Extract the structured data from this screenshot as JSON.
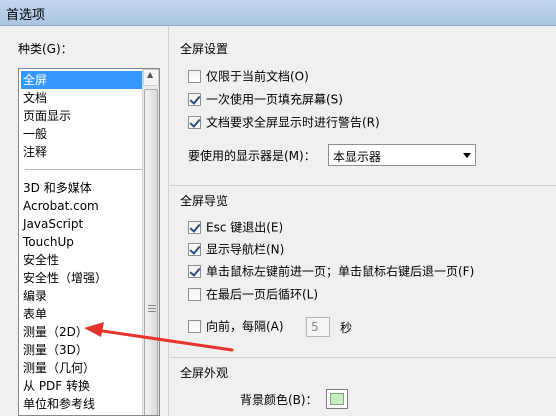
{
  "window": {
    "title": "首选项"
  },
  "categories": {
    "label": "种类(G)：",
    "group1": [
      "全屏",
      "文档",
      "页面显示",
      "一般",
      "注释"
    ],
    "group2": [
      "3D 和多媒体",
      "Acrobat.com",
      "JavaScript",
      "TouchUp",
      "安全性",
      "安全性（增强）",
      "编录",
      "表单",
      "测量（2D）",
      "测量（3D）",
      "测量（几何）",
      "从 PDF 转换",
      "单位和参考线"
    ],
    "selected": "全屏"
  },
  "fullscreen_setup": {
    "title": "全屏设置",
    "options": [
      {
        "label": "仅限于当前文档(O)",
        "checked": false
      },
      {
        "label": "一次使用一页填充屏幕(S)",
        "checked": true
      },
      {
        "label": "文档要求全屏显示时进行警告(R)",
        "checked": true
      }
    ],
    "monitor_label": "要使用的显示器是(M)：",
    "monitor_value": "本显示器"
  },
  "fullscreen_nav": {
    "title": "全屏导览",
    "options": [
      {
        "label": "Esc 键退出(E)",
        "checked": true
      },
      {
        "label": "显示导航栏(N)",
        "checked": true
      },
      {
        "label": "单击鼠标左键前进一页；单击鼠标右键后退一页(F)",
        "checked": true
      },
      {
        "label": "在最后一页后循环(L)",
        "checked": false
      },
      {
        "label": "向前，每隔(A)",
        "checked": false
      }
    ],
    "interval_value": "5",
    "interval_unit": "秒"
  },
  "fullscreen_look": {
    "title": "全屏外观",
    "bg_color_label": "背景颜色(B)：",
    "bg_color": "#c6eec0"
  },
  "annotation": {
    "arrow_color": "#e8332b"
  }
}
